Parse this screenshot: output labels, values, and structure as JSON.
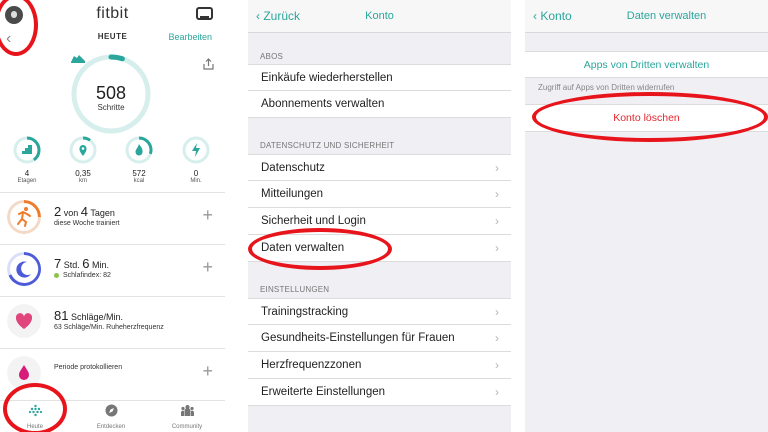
{
  "colors": {
    "accent": "#2aa69c",
    "destructive": "#e3262d",
    "highlight": "#e8141b"
  },
  "fitbit": {
    "brand": "fitbit",
    "today_label": "HEUTE",
    "edit_label": "Bearbeiten",
    "steps": {
      "value": "508",
      "label": "Schritte",
      "goal_fraction": 0.05
    },
    "stats": [
      {
        "value": "4",
        "label": "Etagen",
        "icon": "stairs-icon",
        "fraction": 0.4
      },
      {
        "value": "0,35",
        "label": "km",
        "icon": "location-pin-icon",
        "fraction": 0.1
      },
      {
        "value": "572",
        "label": "kcal",
        "icon": "flame-icon",
        "fraction": 0.3
      },
      {
        "value": "0",
        "label": "Min.",
        "icon": "bolt-icon",
        "fraction": 0.0
      }
    ],
    "tiles": {
      "exercise": {
        "n1": "2",
        "mid": "von",
        "n2": "4",
        "tail": "Tagen",
        "sub": "diese Woche trainiert"
      },
      "sleep": {
        "h": "7",
        "h_unit": "Std.",
        "m": "6",
        "m_unit": "Min.",
        "sub": "Schlafindex: 82"
      },
      "heart": {
        "value": "81",
        "unit": "Schläge/Min.",
        "sub": "63 Schläge/Min. Ruheherzfrequenz"
      },
      "period": {
        "label": "Periode protokollieren"
      }
    },
    "tabs": [
      {
        "label": "Heute",
        "icon": "dots-grid-icon"
      },
      {
        "label": "Entdecken",
        "icon": "compass-icon"
      },
      {
        "label": "Community",
        "icon": "people-icon"
      }
    ]
  },
  "account": {
    "back_label": "Zurück",
    "title": "Konto",
    "sections": [
      {
        "header": "ABOS",
        "items": [
          {
            "label": "Einkäufe wiederherstellen",
            "chevron": false
          },
          {
            "label": "Abonnements verwalten",
            "chevron": false
          }
        ]
      },
      {
        "header": "DATENSCHUTZ UND SICHERHEIT",
        "items": [
          {
            "label": "Datenschutz",
            "chevron": true
          },
          {
            "label": "Mitteilungen",
            "chevron": true
          },
          {
            "label": "Sicherheit und Login",
            "chevron": true
          },
          {
            "label": "Daten verwalten",
            "chevron": true
          }
        ]
      },
      {
        "header": "EINSTELLUNGEN",
        "items": [
          {
            "label": "Trainingstracking",
            "chevron": true
          },
          {
            "label": "Gesundheits-Einstellungen für Frauen",
            "chevron": true
          },
          {
            "label": "Herzfrequenzzonen",
            "chevron": true
          },
          {
            "label": "Erweiterte Einstellungen",
            "chevron": true
          }
        ]
      }
    ]
  },
  "manage_data": {
    "back_label": "Konto",
    "title": "Daten verwalten",
    "third_party_label": "Apps von Dritten verwalten",
    "third_party_note": "Zugriff auf Apps von Dritten widerrufen",
    "delete_label": "Konto löschen"
  }
}
